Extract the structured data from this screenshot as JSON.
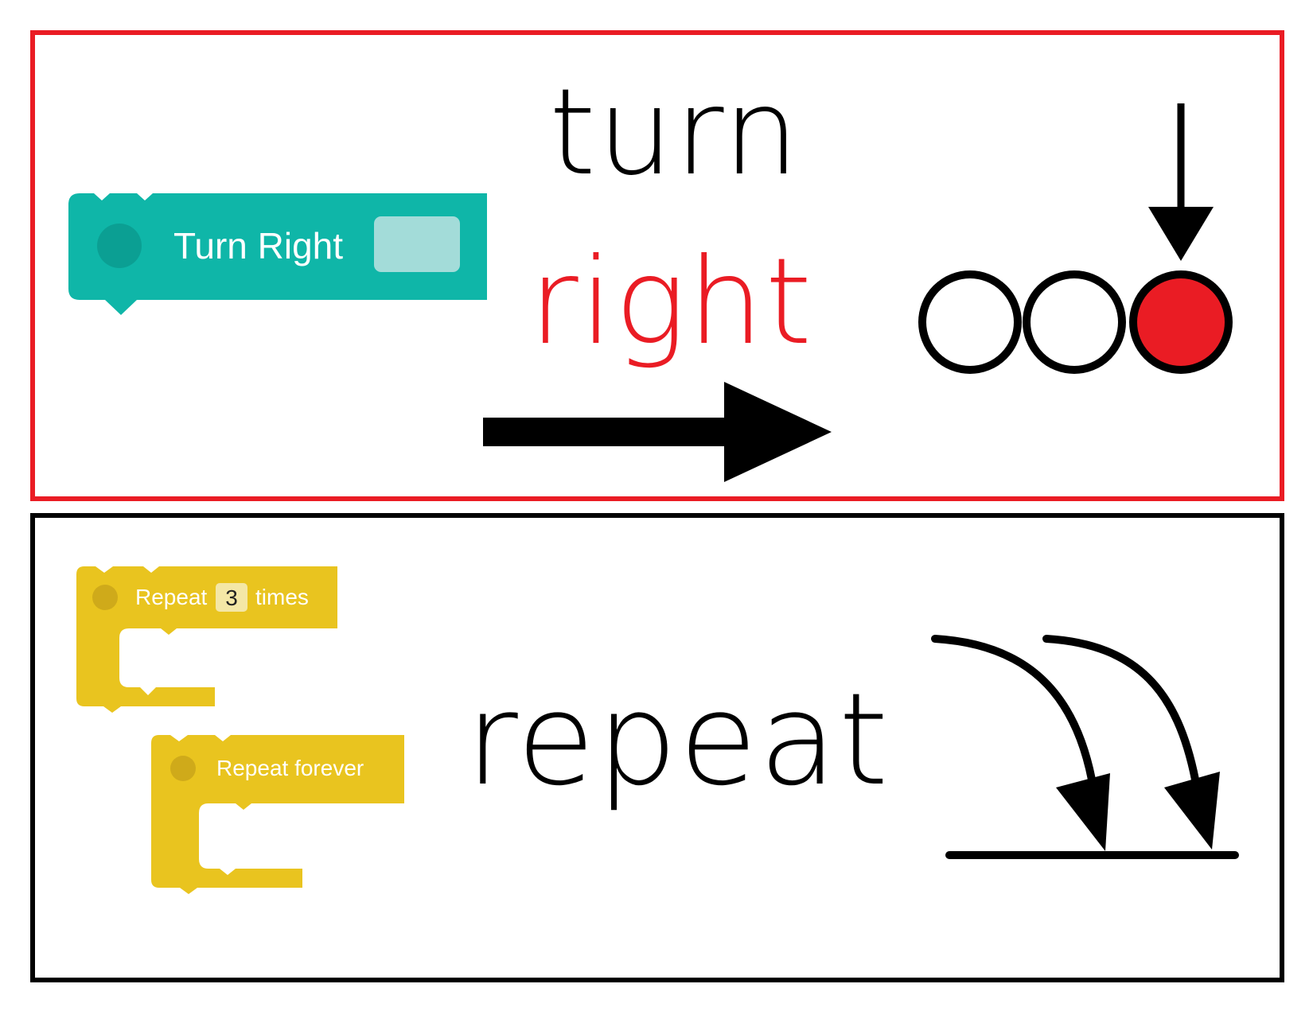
{
  "turn_card": {
    "block": {
      "label": "Turn Right",
      "color": "#0fb6a8"
    },
    "word_line1": "turn",
    "word_line2": "right",
    "highlight_color": "#ea1c24",
    "circles": [
      {
        "state": "empty"
      },
      {
        "state": "empty"
      },
      {
        "state": "filled"
      }
    ],
    "icons": [
      "right-arrow-icon",
      "down-arrow-icon"
    ]
  },
  "repeat_card": {
    "block_times": {
      "prefix": "Repeat",
      "count": "3",
      "suffix": "times",
      "color": "#e9c41f"
    },
    "block_forever": {
      "label": "Repeat forever",
      "color": "#e9c41f"
    },
    "word": "repeat",
    "icons": [
      "curved-arrow-icon",
      "curved-arrow-icon"
    ]
  }
}
